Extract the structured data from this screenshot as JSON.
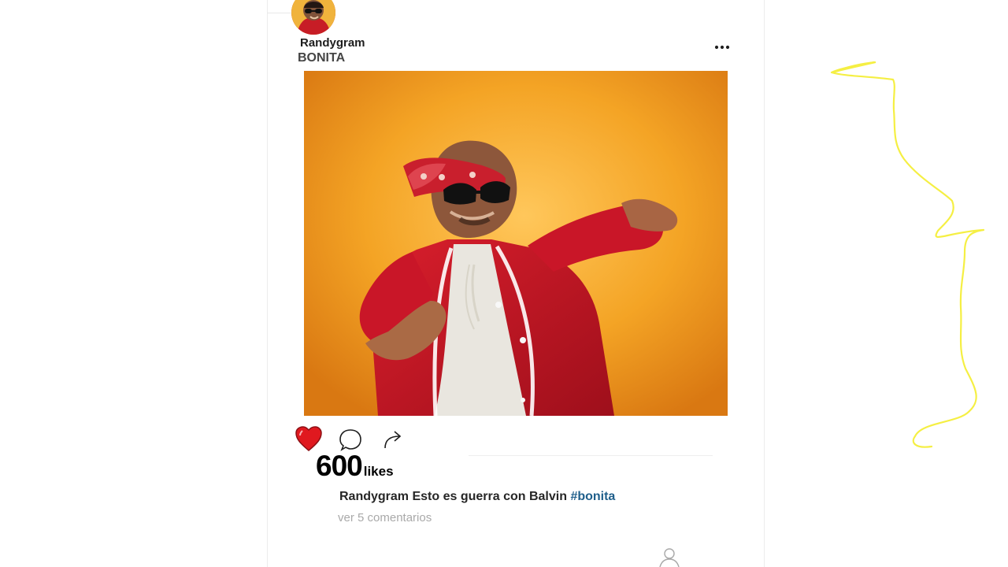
{
  "post": {
    "username": "Randygram",
    "location": "BONITA",
    "likes_count": "600",
    "likes_label": "likes",
    "caption_user": "Randygram",
    "caption_text": " Esto es guerra con Balvin ",
    "caption_hashtag": "#bonita",
    "view_comments": "ver 5 comentarios",
    "liked": true
  },
  "icons": {
    "more": "more-dots-icon",
    "like": "heart-filled-icon",
    "comment": "comment-bubble-icon",
    "share": "share-arrow-icon",
    "profile": "user-profile-icon"
  },
  "colors": {
    "heart": "#e0191f",
    "hashtag": "#1f5f8b",
    "photo_background": "#f4a425",
    "annotation_stroke": "#f5ef43"
  }
}
